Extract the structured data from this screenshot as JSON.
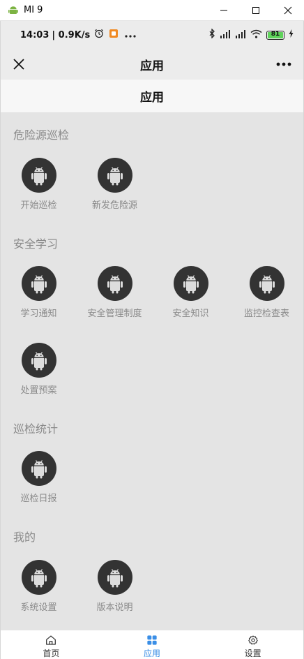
{
  "window": {
    "title": "MI 9"
  },
  "status_bar": {
    "time": "14:03",
    "rate": "| 0.9K/s",
    "battery": "81"
  },
  "nav": {
    "title": "应用"
  },
  "page": {
    "title": "应用"
  },
  "sections": [
    {
      "title": "危险源巡检",
      "items": [
        {
          "label": "开始巡检"
        },
        {
          "label": "新发危险源"
        }
      ]
    },
    {
      "title": "安全学习",
      "items": [
        {
          "label": "学习通知"
        },
        {
          "label": "安全管理制度"
        },
        {
          "label": "安全知识"
        },
        {
          "label": "监控检查表"
        },
        {
          "label": "处置预案"
        }
      ]
    },
    {
      "title": "巡检统计",
      "items": [
        {
          "label": "巡检日报"
        }
      ]
    },
    {
      "title": "我的",
      "items": [
        {
          "label": "系统设置"
        },
        {
          "label": "版本说明"
        }
      ]
    }
  ],
  "tabs": [
    {
      "label": "首页",
      "icon": "home-icon"
    },
    {
      "label": "应用",
      "icon": "grid-icon"
    },
    {
      "label": "设置",
      "icon": "gear-icon"
    }
  ],
  "colors": {
    "active_tab": "#3a8ee6",
    "app_icon_bg": "#333333",
    "page_bg": "#e4e4e4"
  }
}
